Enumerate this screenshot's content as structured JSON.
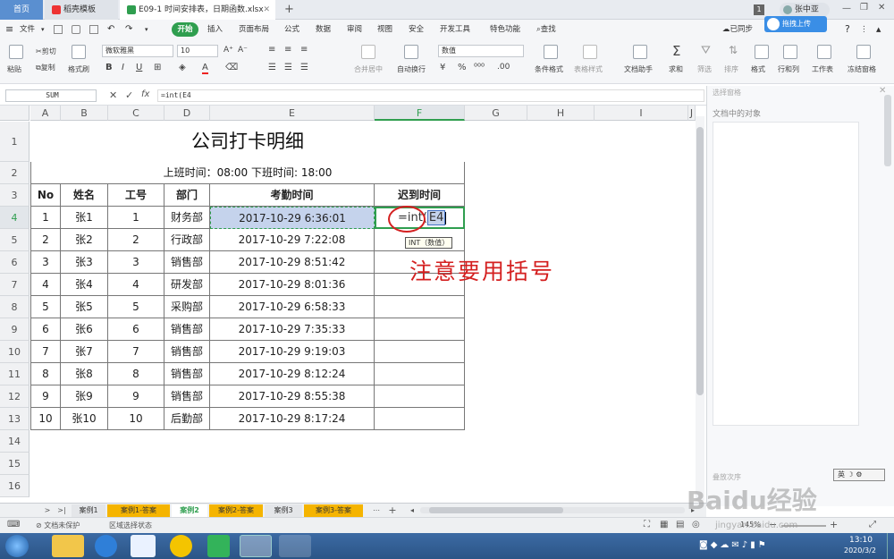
{
  "tabs": {
    "home": "首页",
    "template": "稻壳模板",
    "file": "E09-1 时间安排表，日期函数.xlsx",
    "new_tab": "+",
    "badge": "1",
    "user": "张中亚"
  },
  "menu": {
    "file": "文件",
    "start": "开始",
    "insert": "插入",
    "layout": "页面布局",
    "formula": "公式",
    "data": "数据",
    "review": "审阅",
    "view": "视图",
    "security": "安全",
    "dev": "开发工具",
    "special": "特色功能",
    "search": "查找",
    "sync": "已同步",
    "collab": "协作",
    "share": "分享",
    "upload": "拖拽上传"
  },
  "ribbon": {
    "paste": "粘贴",
    "cut": "剪切",
    "copy": "复制",
    "format_painter": "格式刷",
    "font_name": "微软雅黑",
    "font_size": "10",
    "merge": "合并居中",
    "wrap": "自动换行",
    "number_format": "数值",
    "cond_format": "条件格式",
    "table_style": "表格样式",
    "doc_helper": "文档助手",
    "sum": "求和",
    "filter": "筛选",
    "sort": "排序",
    "format": "格式",
    "rowcol": "行和列",
    "sheet": "工作表",
    "freeze": "冻结窗格"
  },
  "formula_bar": {
    "name_box": "SUM",
    "fx": "fx",
    "content": "=int(E4"
  },
  "columns": [
    "A",
    "B",
    "C",
    "D",
    "E",
    "F",
    "G",
    "H",
    "I",
    "J"
  ],
  "rows": [
    "1",
    "2",
    "3",
    "4",
    "5",
    "6",
    "7",
    "8",
    "9",
    "10",
    "11",
    "12",
    "13",
    "14",
    "15",
    "16"
  ],
  "sheet": {
    "title": "公司打卡明细",
    "subtitle": "上班时间：08:00    下班时间: 18:00",
    "headers": [
      "No",
      "姓名",
      "工号",
      "部门",
      "考勤时间",
      "迟到时间"
    ],
    "data": [
      [
        "1",
        "张1",
        "1",
        "财务部",
        "2017-10-29 6:36:01"
      ],
      [
        "2",
        "张2",
        "2",
        "行政部",
        "2017-10-29 7:22:08"
      ],
      [
        "3",
        "张3",
        "3",
        "销售部",
        "2017-10-29 8:51:42"
      ],
      [
        "4",
        "张4",
        "4",
        "研发部",
        "2017-10-29 8:01:36"
      ],
      [
        "5",
        "张5",
        "5",
        "采购部",
        "2017-10-29 6:58:33"
      ],
      [
        "6",
        "张6",
        "6",
        "销售部",
        "2017-10-29 7:35:33"
      ],
      [
        "7",
        "张7",
        "7",
        "销售部",
        "2017-10-29 9:19:03"
      ],
      [
        "8",
        "张8",
        "8",
        "销售部",
        "2017-10-29 8:12:24"
      ],
      [
        "9",
        "张9",
        "9",
        "销售部",
        "2017-10-29 8:55:38"
      ],
      [
        "10",
        "张10",
        "10",
        "后勤部",
        "2017-10-29 8:17:24"
      ]
    ],
    "edit_text": "=int(",
    "edit_ref": "E4",
    "tooltip": "INT（数值）",
    "annotation": "注意要用括号"
  },
  "right_pane": {
    "title": "选择窗格",
    "objects": "文档中的对象",
    "order": "叠放次序"
  },
  "sheet_tabs": [
    "案例1",
    "案例1-答案",
    "案例2",
    "案例2-答案",
    "案例3",
    "案例3-答案"
  ],
  "status": {
    "protect": "文档未保护",
    "mode": "区域选择状态",
    "zoom": "145%"
  },
  "ime": "英",
  "taskbar": {
    "time": "13:10",
    "date": "2020/3/2"
  },
  "watermark": "Baidu经验",
  "watermark_url": "jingyan.baidu.com",
  "colors": {
    "accent": "#2f9e4f",
    "selected_cell": "#c5d3ec",
    "annotation_red": "#d42020",
    "tab_orange": "#f5b400"
  }
}
